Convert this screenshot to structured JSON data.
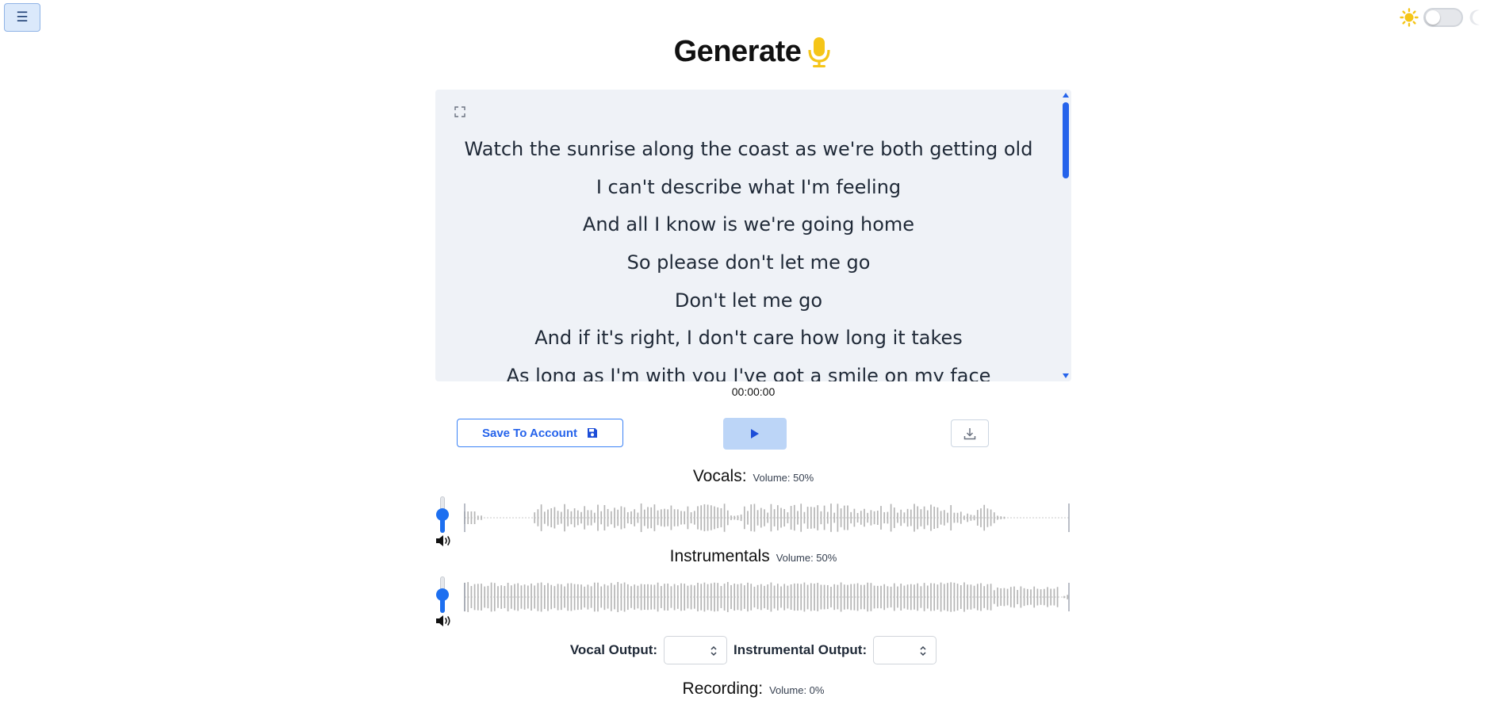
{
  "header": {
    "menu_icon": "hamburger-icon",
    "title": "Generate",
    "title_icon": "microphone-icon",
    "theme_toggle": {
      "sun_icon": "sun-icon",
      "moon_icon": "moon-icon",
      "dark_mode": false
    }
  },
  "lyrics": {
    "expand_icon": "expand-icon",
    "lines": [
      "Watch the sunrise along the coast as we're both getting old",
      "I can't describe what I'm feeling",
      "And all I know is we're going home",
      "So please don't let me go",
      "Don't let me go",
      "And if it's right, I don't care how long it takes",
      "As long as I'm with you I've got a smile on my face"
    ]
  },
  "player": {
    "timecode": "00:00:00",
    "save_label": "Save To Account",
    "save_icon": "floppy-disk-icon",
    "play_icon": "play-icon",
    "download_icon": "download-icon"
  },
  "tracks": {
    "vocals": {
      "name": "Vocals:",
      "volume_text": "Volume: 50%",
      "volume": 0.5
    },
    "instrumentals": {
      "name": "Instrumentals",
      "volume_text": "Volume: 50%",
      "volume": 0.5
    }
  },
  "outputs": {
    "vocal_label": "Vocal Output:",
    "vocal_value": "",
    "instrumental_label": "Instrumental Output:",
    "instrumental_value": ""
  },
  "recording": {
    "name": "Recording:",
    "volume_text": "Volume: 0%"
  },
  "colors": {
    "accent": "#1d6ff0",
    "icon_yellow": "#f5c518",
    "panel": "#eff2f7"
  }
}
